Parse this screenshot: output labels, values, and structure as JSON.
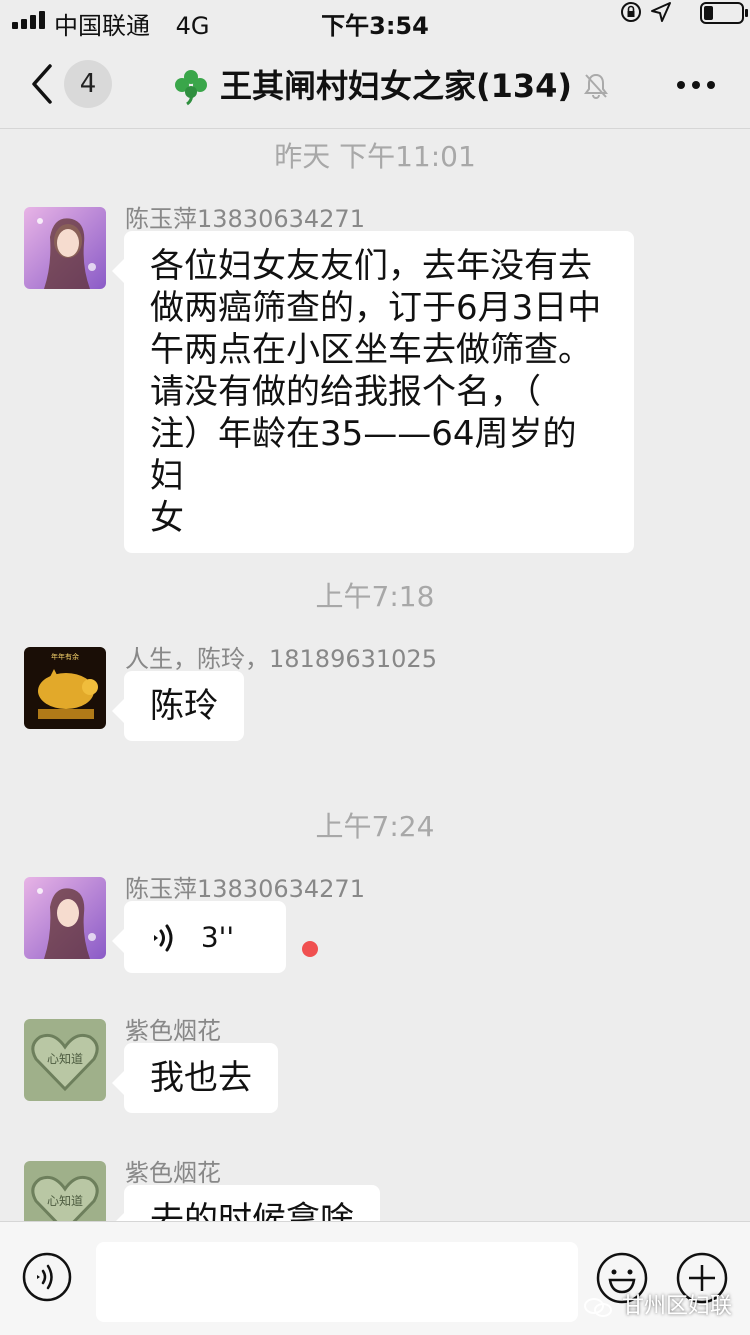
{
  "status_bar": {
    "carrier": "中国联通",
    "network": "4G",
    "time": "下午3:54",
    "signal_bars": 4,
    "battery_level": 0.25
  },
  "nav": {
    "unread_count": "4",
    "title": "王其闸村妇女之家(134)",
    "icons": [
      "back-icon",
      "clover-icon",
      "mute-bell-icon",
      "more-icon"
    ]
  },
  "messages": {
    "time_1": "昨天 下午11:01",
    "msg_1": {
      "sender": "陈玉萍13830634271",
      "text": "各位妇女友友们，去年没有去\n做两癌筛查的，订于6月3日中\n午两点在小区坐车去做筛查。\n请没有做的给我报个名，（\n注）年龄在35——64周岁的妇\n女"
    },
    "time_2": "上午7:18",
    "msg_2": {
      "sender": "人生，陈玲，18189631025",
      "text": "陈玲",
      "avatar_caption": "年年有余"
    },
    "time_3": "上午7:24",
    "msg_3": {
      "sender": "陈玉萍13830634271",
      "voice_duration": "3''",
      "unread": true
    },
    "msg_4": {
      "sender": "紫色烟花",
      "text": "我也去",
      "avatar_caption": "心知道"
    },
    "msg_5": {
      "sender": "紫色烟花",
      "text": "去的时候拿啥",
      "avatar_caption": "心知道"
    }
  },
  "input_bar": {
    "placeholder": "",
    "watermark": "甘州区妇联",
    "icons": [
      "voice-toggle-icon",
      "emoji-icon",
      "plus-icon"
    ]
  },
  "colors": {
    "background": "#ededed",
    "bubble": "#ffffff",
    "time_text": "#a8a8a8",
    "sender_text": "#888888",
    "unread_dot": "#f05050"
  }
}
